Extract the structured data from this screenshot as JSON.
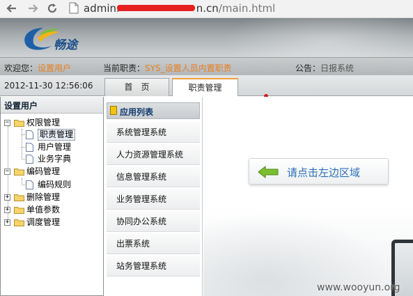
{
  "browser": {
    "back_icon": "back-arrow-icon",
    "forward_icon": "forward-arrow-icon",
    "reload_icon": "reload-icon",
    "url_host_start": "admin.",
    "url_host_end": "n.cn",
    "url_path": "/main.html"
  },
  "header": {
    "logo_text": "畅途",
    "accent_color": "#e87f1e"
  },
  "info_bar": {
    "welcome_label": "欢迎您：",
    "welcome_user": "设置用户",
    "role_label": "当前职责：",
    "role_value": "SYS_设置人员内置职责",
    "notice_label": "公告：",
    "notice_value": "日报系统"
  },
  "tab_bar": {
    "datetime": "2012-11-30 12:56:06",
    "tabs": [
      {
        "label": "首　页",
        "active": false
      },
      {
        "label": "职责管理",
        "active": true
      }
    ]
  },
  "tree": {
    "title": "设置用户",
    "nodes": [
      {
        "label": "权限管理",
        "expander": "−"
      },
      {
        "label": "职责管理"
      },
      {
        "label": "用户管理"
      },
      {
        "label": "业务字典"
      },
      {
        "label": "编码管理",
        "expander": "−"
      },
      {
        "label": "编码规则"
      },
      {
        "label": "删除管理",
        "expander": "+"
      },
      {
        "label": "单值参数",
        "expander": "+"
      },
      {
        "label": "调度管理",
        "expander": "+"
      }
    ]
  },
  "app_list": {
    "title": "应用列表",
    "items": [
      "系统管理系统",
      "人力资源管理系统",
      "信息管理系统",
      "业务管理系统",
      "协同办公系统",
      "出票系统",
      "站务管理系统"
    ]
  },
  "main": {
    "hint": "请点击左边区域"
  },
  "watermark": "www.wooyun.org"
}
